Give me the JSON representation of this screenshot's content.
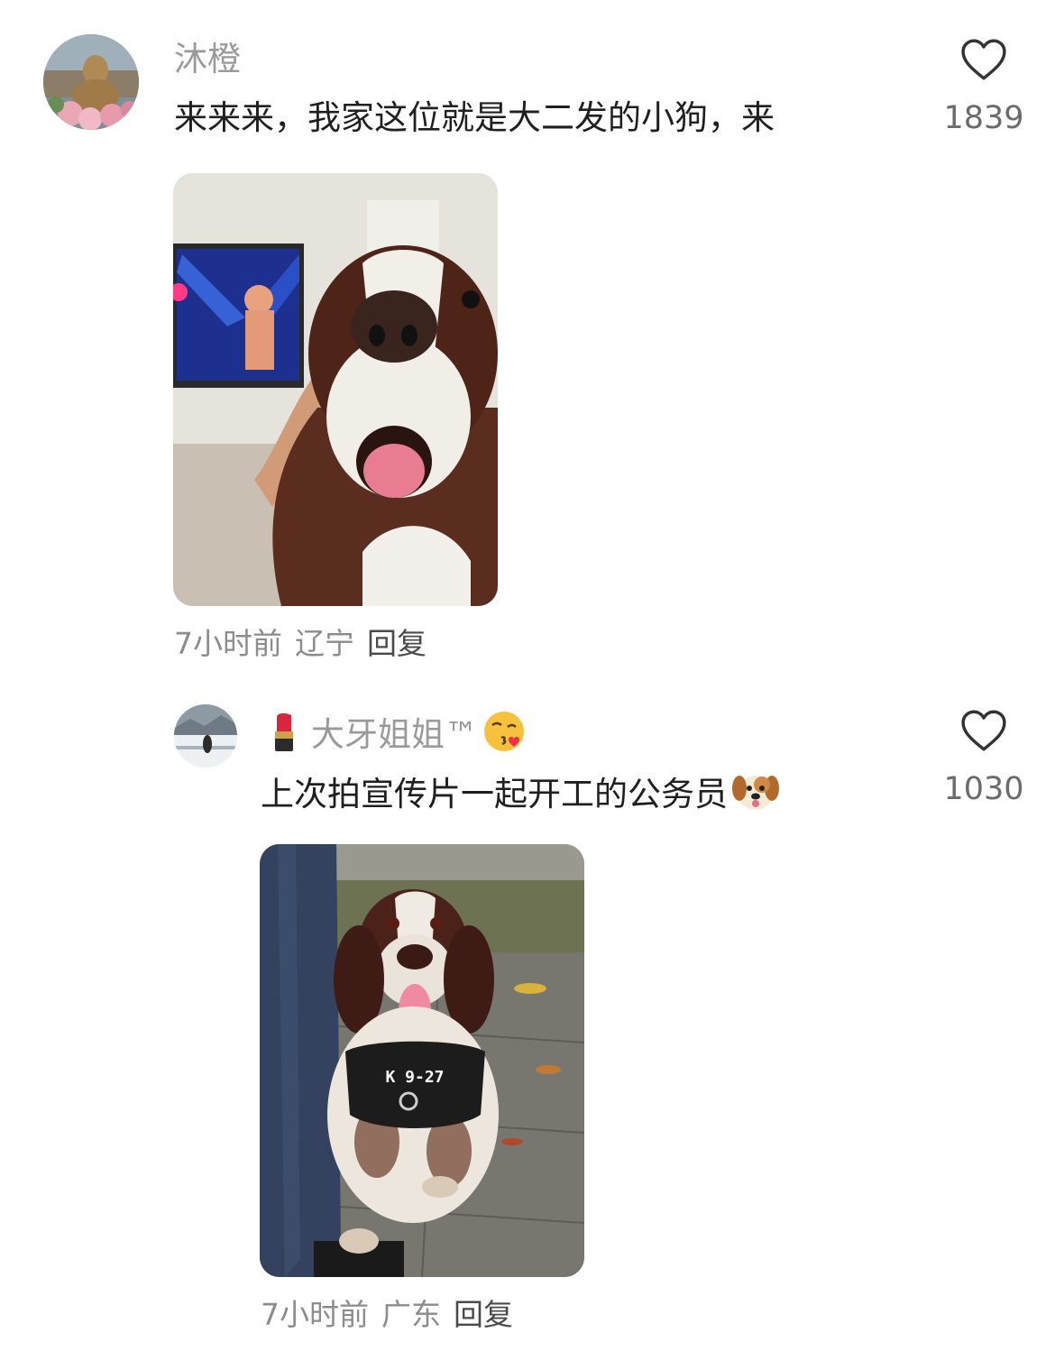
{
  "comments": [
    {
      "username": "沐橙",
      "text": "来来来，我家这位就是大二发的小狗，来",
      "likes": "1839",
      "time": "7小时前",
      "location": "辽宁",
      "reply_label": "回复",
      "avatar_icon": "buddha-statue-flowers-avatar",
      "photo_subject": "dog-with-tv-photo"
    },
    {
      "username": "大牙姐姐™",
      "username_prefix_icon": "lipstick-icon",
      "username_suffix_icon": "kissing-face-icon",
      "text": "上次拍宣传片一起开工的公务员",
      "text_suffix_icon": "dog-face-icon",
      "likes": "1030",
      "time": "7小时前",
      "location": "广东",
      "reply_label": "回复",
      "avatar_icon": "snowy-landscape-avatar",
      "photo_subject": "police-dog-harness-photo",
      "harness_text": "K 9-27"
    }
  ],
  "colors": {
    "username": "#9a9a9a",
    "text": "#1f1f1f",
    "meta": "#8c8c8c",
    "heart_outline": "#333333"
  }
}
